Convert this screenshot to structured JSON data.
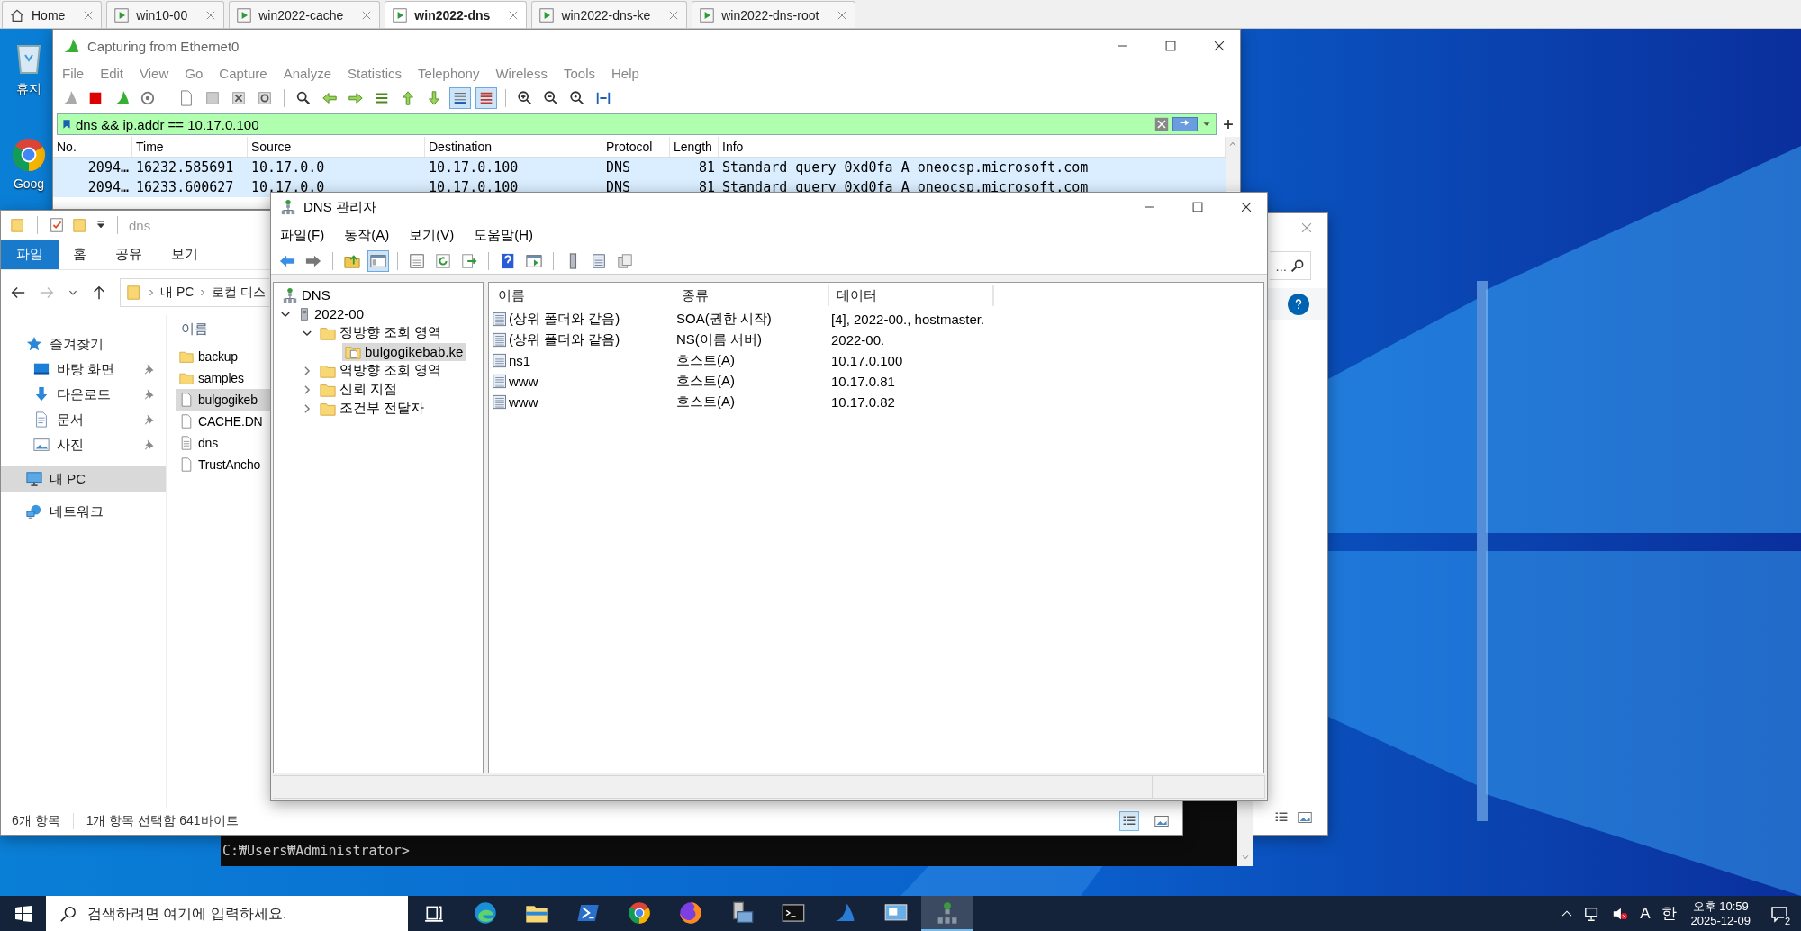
{
  "browser_tabs": [
    {
      "label": "Home",
      "kind": "home",
      "selected": false
    },
    {
      "label": "win10-00",
      "kind": "vm",
      "selected": false
    },
    {
      "label": "win2022-cache",
      "kind": "vm",
      "selected": false
    },
    {
      "label": "win2022-dns",
      "kind": "vm",
      "selected": true
    },
    {
      "label": "win2022-dns-ke",
      "kind": "vm",
      "selected": false
    },
    {
      "label": "win2022-dns-root",
      "kind": "vm",
      "selected": false
    }
  ],
  "desktop_icons": [
    {
      "label": "휴지",
      "kind": "recycle"
    },
    {
      "label": "Goog",
      "kind": "chrome"
    }
  ],
  "wireshark": {
    "title": "Capturing from Ethernet0",
    "menu": [
      "File",
      "Edit",
      "View",
      "Go",
      "Capture",
      "Analyze",
      "Statistics",
      "Telephony",
      "Wireless",
      "Tools",
      "Help"
    ],
    "filter": "dns && ip.addr == 10.17.0.100",
    "columns": [
      "No.",
      "Time",
      "Source",
      "Destination",
      "Protocol",
      "Length",
      "Info"
    ],
    "rows": [
      [
        "2094…",
        "16232.585691",
        "10.17.0.0",
        "10.17.0.100",
        "DNS",
        "81",
        "Standard query 0xd0fa A oneocsp.microsoft.com"
      ],
      [
        "2094…",
        "16233.600627",
        "10.17.0.0",
        "10.17.0.100",
        "DNS",
        "81",
        "Standard query 0xd0fa A oneocsp.microsoft.com"
      ]
    ]
  },
  "explorer": {
    "title": "dns",
    "ribbon_tabs": [
      {
        "label": "파일",
        "selected": true
      },
      {
        "label": "홈",
        "selected": false
      },
      {
        "label": "공유",
        "selected": false
      },
      {
        "label": "보기",
        "selected": false
      }
    ],
    "path": [
      "내 PC",
      "로컬 디스"
    ],
    "nav": [
      {
        "label": "즐겨찾기",
        "kind": "star",
        "pinned": false,
        "selected": false
      },
      {
        "label": "바탕 화면",
        "kind": "desktop",
        "pinned": true,
        "selected": false
      },
      {
        "label": "다운로드",
        "kind": "download",
        "pinned": true,
        "selected": false
      },
      {
        "label": "문서",
        "kind": "document",
        "pinned": true,
        "selected": false
      },
      {
        "label": "사진",
        "kind": "pictures",
        "pinned": true,
        "selected": false
      },
      {
        "label": "내 PC",
        "kind": "pc",
        "pinned": false,
        "selected": true
      },
      {
        "label": "네트워크",
        "kind": "network",
        "pinned": false,
        "selected": false
      }
    ],
    "column": "이름",
    "files": [
      {
        "name": "backup",
        "kind": "folder",
        "selected": false
      },
      {
        "name": "samples",
        "kind": "folder",
        "selected": false
      },
      {
        "name": "bulgogikeb",
        "kind": "file",
        "selected": true
      },
      {
        "name": "CACHE.DN",
        "kind": "file",
        "selected": false
      },
      {
        "name": "dns",
        "kind": "text",
        "selected": false
      },
      {
        "name": "TrustAncho",
        "kind": "file",
        "selected": false
      }
    ],
    "status": [
      "6개 항목",
      "1개 항목 선택함 641바이트"
    ]
  },
  "explorer_behind": {
    "search_placeholder": "..."
  },
  "console": {
    "prompt": "C:₩Users₩Administrator>"
  },
  "dns_manager": {
    "title": "DNS 관리자",
    "menu": [
      "파일(F)",
      "동작(A)",
      "보기(V)",
      "도움말(H)"
    ],
    "tree": [
      {
        "label": "DNS",
        "kind": "root",
        "selected": false,
        "children": [
          {
            "label": "2022-00",
            "kind": "server",
            "selected": false,
            "expanded": true,
            "children": [
              {
                "label": "정방향 조회 영역",
                "kind": "folder",
                "selected": false,
                "expanded": true,
                "children": [
                  {
                    "label": "bulgogikebab.ke",
                    "kind": "zone",
                    "selected": true
                  }
                ]
              },
              {
                "label": "역방향 조회 영역",
                "kind": "folder",
                "selected": false,
                "expanded": false
              },
              {
                "label": "신뢰 지점",
                "kind": "folder",
                "selected": false,
                "expanded": false
              },
              {
                "label": "조건부 전달자",
                "kind": "folder",
                "selected": false,
                "expanded": false
              }
            ]
          }
        ]
      }
    ],
    "columns": [
      "이름",
      "종류",
      "데이터"
    ],
    "records": [
      {
        "name": "(상위 폴더와 같음)",
        "type": "SOA(권한 시작)",
        "data": "[4], 2022-00., hostmaster."
      },
      {
        "name": "(상위 폴더와 같음)",
        "type": "NS(이름 서버)",
        "data": "2022-00."
      },
      {
        "name": "ns1",
        "type": "호스트(A)",
        "data": "10.17.0.100"
      },
      {
        "name": "www",
        "type": "호스트(A)",
        "data": "10.17.0.81"
      },
      {
        "name": "www",
        "type": "호스트(A)",
        "data": "10.17.0.82"
      }
    ]
  },
  "taskbar": {
    "search_placeholder": "검색하려면 여기에 입력하세요.",
    "apps": [
      {
        "kind": "taskview",
        "active": false
      },
      {
        "kind": "edge",
        "active": false
      },
      {
        "kind": "explorer",
        "active": false
      },
      {
        "kind": "powershell",
        "active": false
      },
      {
        "kind": "chrome",
        "active": false
      },
      {
        "kind": "firefox",
        "active": false
      },
      {
        "kind": "server",
        "active": false
      },
      {
        "kind": "console",
        "active": false
      },
      {
        "kind": "fin",
        "active": false
      },
      {
        "kind": "monitor",
        "active": false
      },
      {
        "kind": "dns",
        "active": true
      }
    ],
    "ime_mode": "A",
    "ime_lang": "한",
    "time": "오후 10:59",
    "date": "2025-12-09",
    "notifications": "2"
  }
}
